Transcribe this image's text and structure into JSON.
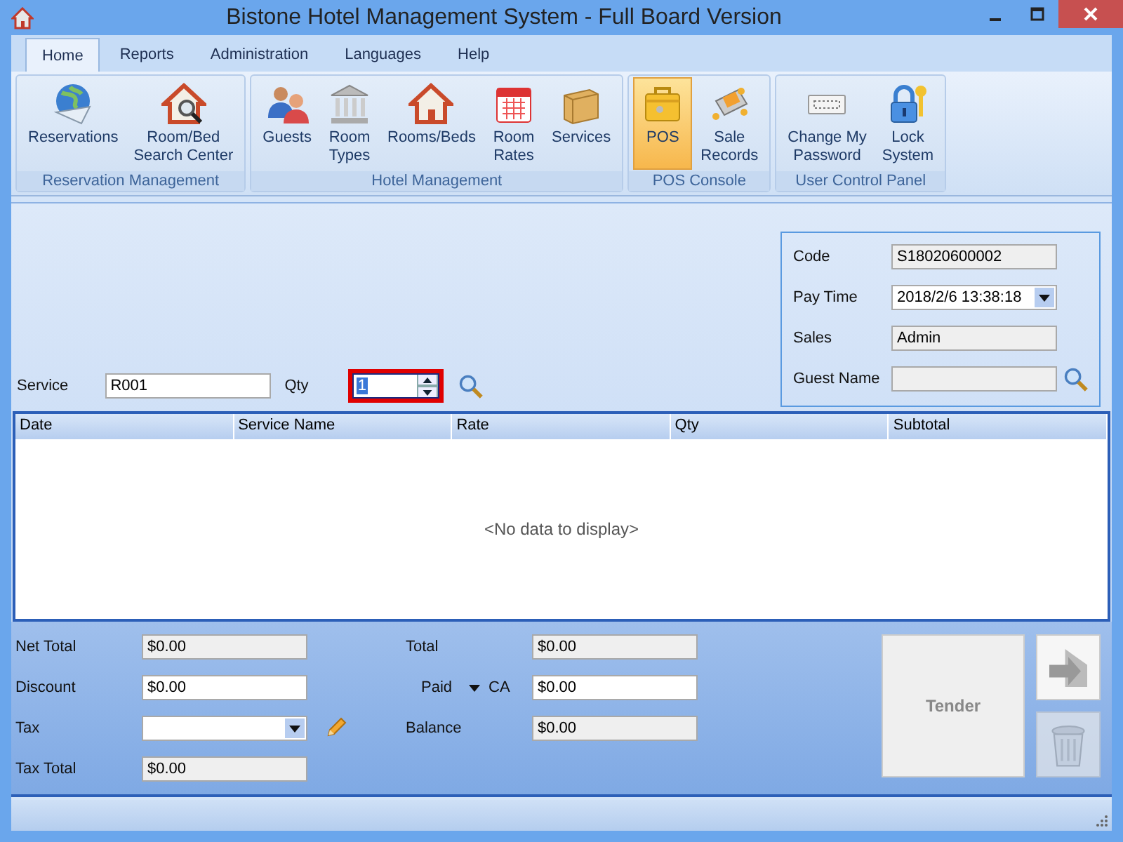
{
  "window": {
    "title": "Bistone Hotel Management System - Full Board Version"
  },
  "tabs": [
    {
      "label": "Home",
      "selected": true
    },
    {
      "label": "Reports",
      "selected": false
    },
    {
      "label": "Administration",
      "selected": false
    },
    {
      "label": "Languages",
      "selected": false
    },
    {
      "label": "Help",
      "selected": false
    }
  ],
  "ribbon": [
    {
      "label": "Reservation Management",
      "items": [
        {
          "label": "Reservations",
          "selected": false
        },
        {
          "label": "Room/Bed\nSearch Center",
          "selected": false
        }
      ]
    },
    {
      "label": "Hotel Management",
      "items": [
        {
          "label": "Guests",
          "selected": false
        },
        {
          "label": "Room\nTypes",
          "selected": false
        },
        {
          "label": "Rooms/Beds",
          "selected": false
        },
        {
          "label": "Room\nRates",
          "selected": false
        },
        {
          "label": "Services",
          "selected": false
        }
      ]
    },
    {
      "label": "POS Console",
      "items": [
        {
          "label": "POS",
          "selected": true
        },
        {
          "label": "Sale\nRecords",
          "selected": false
        }
      ]
    },
    {
      "label": "User Control Panel",
      "items": [
        {
          "label": "Change My\nPassword",
          "selected": false
        },
        {
          "label": "Lock\nSystem",
          "selected": false
        }
      ]
    }
  ],
  "entry": {
    "service": {
      "label": "Service",
      "value": "R001"
    },
    "qty": {
      "label": "Qty",
      "value": "1",
      "focused": true
    }
  },
  "info": [
    {
      "label": "Code",
      "value": "S18020600002",
      "kind": "readonly"
    },
    {
      "label": "Pay Time",
      "value": "2018/2/6 13:38:18",
      "kind": "dropdown"
    },
    {
      "label": "Sales",
      "value": "Admin",
      "kind": "readonly"
    },
    {
      "label": "Guest Name",
      "kind": "search"
    }
  ],
  "table": {
    "columns": [
      "Date",
      "Service Name",
      "Rate",
      "Qty",
      "Subtotal"
    ],
    "empty_message": "<No data to display>"
  },
  "totals_left": [
    {
      "label": "Net Total",
      "value": "$0.00",
      "kind": "readonly"
    },
    {
      "label": "Discount",
      "value": "$0.00",
      "kind": "input"
    },
    {
      "label": "Tax",
      "kind": "dropdown"
    },
    {
      "label": "Tax Total",
      "value": "$0.00",
      "kind": "readonly"
    }
  ],
  "totals_right": [
    {
      "label": "Total",
      "value": "$0.00",
      "kind": "readonly"
    },
    {
      "label": "Paid",
      "method": "CA",
      "value": "$0.00",
      "kind": "payment"
    },
    {
      "label": "Balance",
      "value": "$0.00",
      "kind": "readonly"
    }
  ],
  "buttons": {
    "tender": {
      "label": "Tender",
      "disabled": true
    },
    "transfer": {
      "disabled": false
    },
    "delete": {
      "disabled": true
    }
  }
}
